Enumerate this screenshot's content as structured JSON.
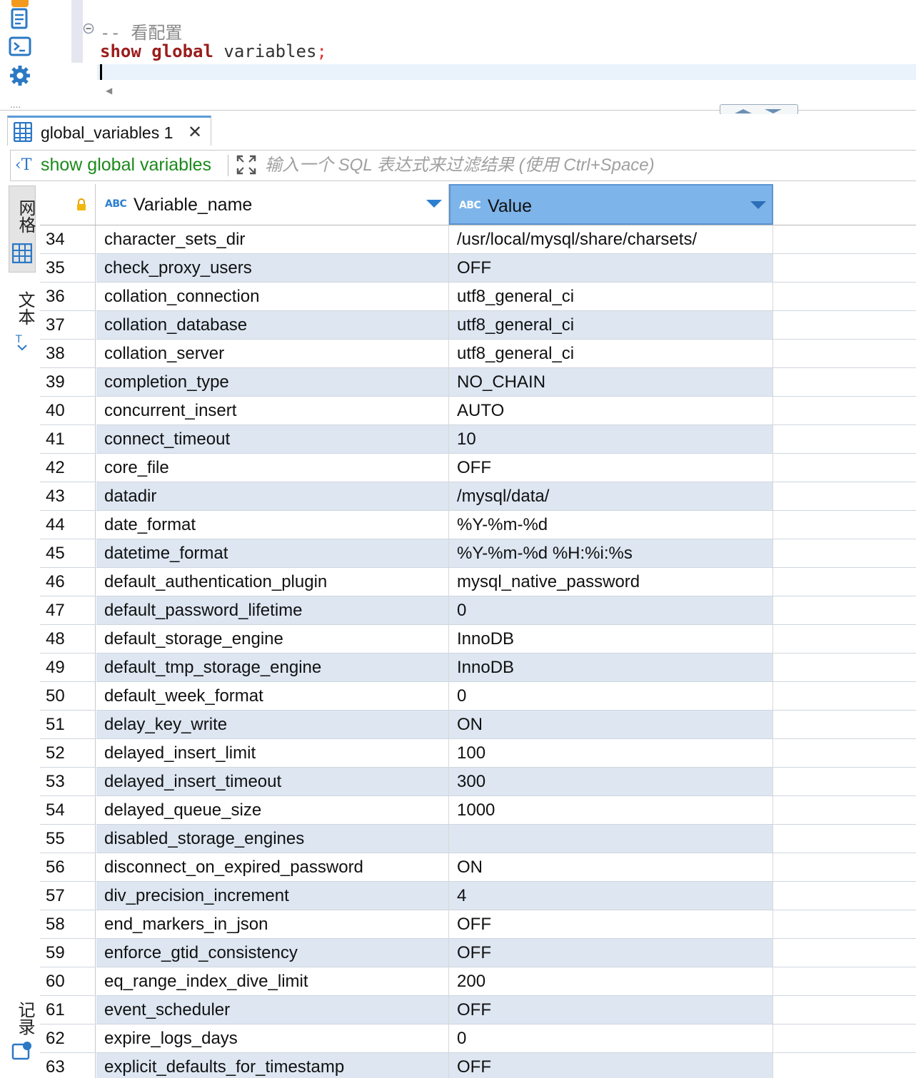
{
  "editor": {
    "comment_line": "-- 看配置",
    "kw_show": "show",
    "kw_global": "global",
    "ident": "variables",
    "semicolon": ";"
  },
  "result_tab": {
    "label": "global_variables 1",
    "close": "✕"
  },
  "filter": {
    "query_label": "show global variables",
    "placeholder": "输入一个 SQL 表达式来过滤结果 (使用 Ctrl+Space)"
  },
  "side_tabs": {
    "grid": "网格",
    "text": "文本",
    "record": "记录"
  },
  "grid": {
    "columns": [
      {
        "type_badge": "ABC",
        "label": "Variable_name"
      },
      {
        "type_badge": "ABC",
        "label": "Value"
      }
    ],
    "rows": [
      {
        "n": "34",
        "name": "character_sets_dir",
        "value": "/usr/local/mysql/share/charsets/"
      },
      {
        "n": "35",
        "name": "check_proxy_users",
        "value": "OFF"
      },
      {
        "n": "36",
        "name": "collation_connection",
        "value": "utf8_general_ci"
      },
      {
        "n": "37",
        "name": "collation_database",
        "value": "utf8_general_ci"
      },
      {
        "n": "38",
        "name": "collation_server",
        "value": "utf8_general_ci"
      },
      {
        "n": "39",
        "name": "completion_type",
        "value": "NO_CHAIN"
      },
      {
        "n": "40",
        "name": "concurrent_insert",
        "value": "AUTO"
      },
      {
        "n": "41",
        "name": "connect_timeout",
        "value": "10"
      },
      {
        "n": "42",
        "name": "core_file",
        "value": "OFF"
      },
      {
        "n": "43",
        "name": "datadir",
        "value": "/mysql/data/"
      },
      {
        "n": "44",
        "name": "date_format",
        "value": "%Y-%m-%d"
      },
      {
        "n": "45",
        "name": "datetime_format",
        "value": "%Y-%m-%d %H:%i:%s"
      },
      {
        "n": "46",
        "name": "default_authentication_plugin",
        "value": "mysql_native_password"
      },
      {
        "n": "47",
        "name": "default_password_lifetime",
        "value": "0"
      },
      {
        "n": "48",
        "name": "default_storage_engine",
        "value": "InnoDB"
      },
      {
        "n": "49",
        "name": "default_tmp_storage_engine",
        "value": "InnoDB"
      },
      {
        "n": "50",
        "name": "default_week_format",
        "value": "0"
      },
      {
        "n": "51",
        "name": "delay_key_write",
        "value": "ON"
      },
      {
        "n": "52",
        "name": "delayed_insert_limit",
        "value": "100"
      },
      {
        "n": "53",
        "name": "delayed_insert_timeout",
        "value": "300"
      },
      {
        "n": "54",
        "name": "delayed_queue_size",
        "value": "1000"
      },
      {
        "n": "55",
        "name": "disabled_storage_engines",
        "value": ""
      },
      {
        "n": "56",
        "name": "disconnect_on_expired_password",
        "value": "ON"
      },
      {
        "n": "57",
        "name": "div_precision_increment",
        "value": "4"
      },
      {
        "n": "58",
        "name": "end_markers_in_json",
        "value": "OFF"
      },
      {
        "n": "59",
        "name": "enforce_gtid_consistency",
        "value": "OFF"
      },
      {
        "n": "60",
        "name": "eq_range_index_dive_limit",
        "value": "200"
      },
      {
        "n": "61",
        "name": "event_scheduler",
        "value": "OFF"
      },
      {
        "n": "62",
        "name": "expire_logs_days",
        "value": "0"
      },
      {
        "n": "63",
        "name": "explicit_defaults_for_timestamp",
        "value": "OFF"
      }
    ]
  },
  "colors": {
    "keyword": "#9b1c1c",
    "selected_header": "#7db4ea",
    "alt_row": "#dde6f1",
    "filter_query": "#1b8a1b",
    "accent_icon": "#2c7fd0"
  }
}
